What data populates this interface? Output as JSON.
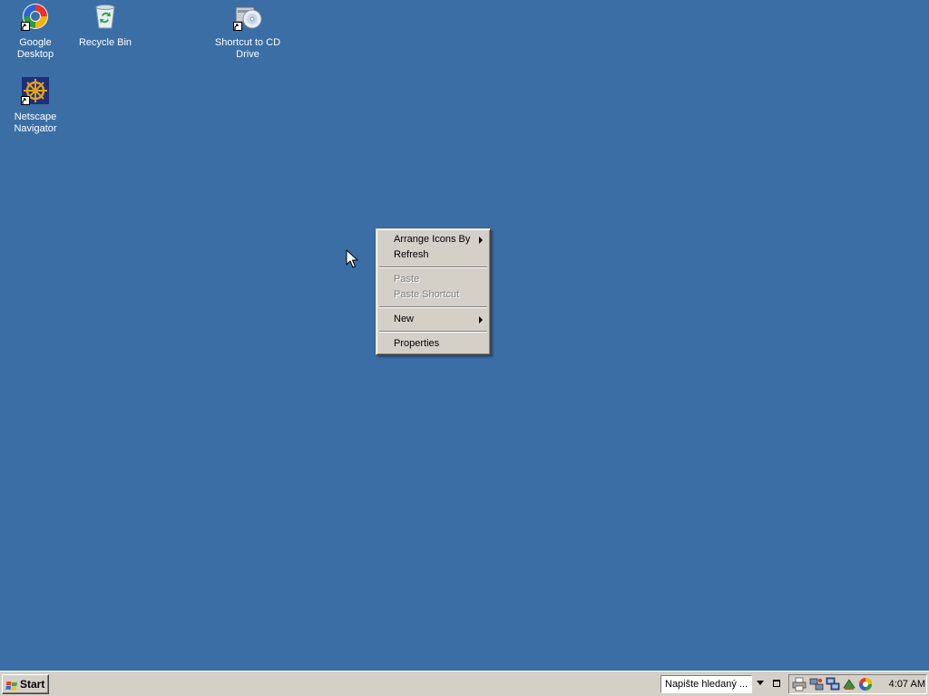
{
  "desktop": {
    "background_color": "#3a6ea5",
    "icons": [
      {
        "label": "Google Desktop",
        "icon": "google-desktop-icon"
      },
      {
        "label": "Recycle Bin",
        "icon": "recycle-bin-icon"
      },
      {
        "label": "Shortcut to CD Drive",
        "icon": "cd-drive-icon"
      },
      {
        "label": "Netscape Navigator",
        "icon": "netscape-icon"
      }
    ]
  },
  "context_menu": {
    "items": [
      {
        "label": "Arrange Icons By",
        "submenu": true,
        "enabled": true
      },
      {
        "label": "Refresh",
        "submenu": false,
        "enabled": true
      },
      {
        "label": "Paste",
        "submenu": false,
        "enabled": false
      },
      {
        "label": "Paste Shortcut",
        "submenu": false,
        "enabled": false
      },
      {
        "label": "New",
        "submenu": true,
        "enabled": true
      },
      {
        "label": "Properties",
        "submenu": false,
        "enabled": true
      }
    ]
  },
  "taskbar": {
    "start_label": "Start",
    "search_placeholder": "Napište hledaný ...",
    "clock": "4:07 AM",
    "tray_icons": [
      "printer-icon",
      "network-icon",
      "network-connections-icon",
      "antivirus-icon",
      "google-desktop-tray-icon"
    ]
  }
}
